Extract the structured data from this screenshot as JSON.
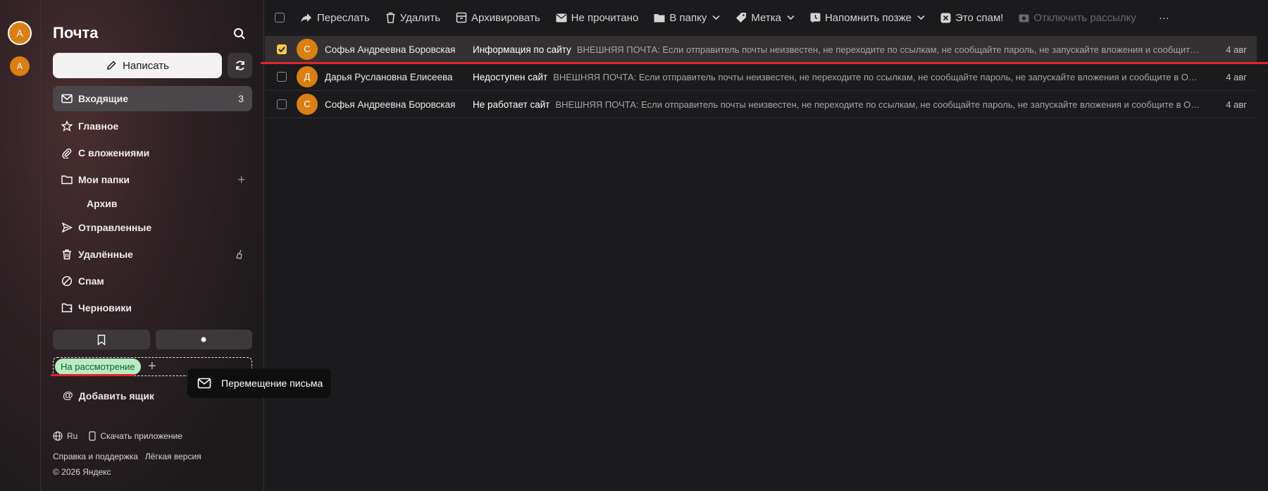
{
  "accounts": {
    "main_initial": "А",
    "secondary_initial": "А"
  },
  "sidebar": {
    "title": "Почта",
    "compose_label": "Написать",
    "items": [
      {
        "label": "Входящие",
        "icon": "envelope-icon",
        "count": "3"
      },
      {
        "label": "Главное",
        "icon": "star-icon"
      },
      {
        "label": "С вложениями",
        "icon": "paperclip-icon"
      },
      {
        "label": "Мои папки",
        "icon": "folder-icon"
      },
      {
        "label": "Архив"
      },
      {
        "label": "Отправленные",
        "icon": "send-icon"
      },
      {
        "label": "Удалённые",
        "icon": "trash-icon"
      },
      {
        "label": "Спам",
        "icon": "spam-icon"
      },
      {
        "label": "Черновики",
        "icon": "draft-icon"
      }
    ],
    "label_chip": "На рассмотрение",
    "add_box": "Добавить ящик",
    "footer": {
      "lang": "Ru",
      "download_app": "Скачать приложение",
      "help": "Справка и поддержка",
      "lite": "Лёгкая версия",
      "copyright": "© 2026 Яндекс"
    }
  },
  "tooltip": {
    "text": "Перемещение письма"
  },
  "toolbar": {
    "forward": "Переслать",
    "delete": "Удалить",
    "archive": "Архивировать",
    "unread": "Не прочитано",
    "to_folder": "В папку",
    "label": "Метка",
    "remind": "Напомнить позже",
    "spam": "Это спам!",
    "unsubscribe": "Отключить рассылку",
    "more": "···"
  },
  "messages": [
    {
      "initial": "С",
      "sender": "Софья Андреевна Боровская",
      "subject": "Информация по сайту",
      "snippet": "ВНЕШНЯЯ ПОЧТА: Если отправитель почты неизвестен, не переходите по ссылкам, не сообщайте пароль, не запускайте вложения и сообщит…",
      "date": "4 авг",
      "selected": true
    },
    {
      "initial": "Д",
      "sender": "Дарья Руслановна Елисеева",
      "subject": "Недоступен сайт",
      "snippet": "ВНЕШНЯЯ ПОЧТА: Если отправитель почты неизвестен, не переходите по ссылкам, не сообщайте пароль, не запускайте вложения и сообщите в О…",
      "date": "4 авг",
      "selected": false
    },
    {
      "initial": "С",
      "sender": "Софья Андреевна Боровская",
      "subject": "Не работает сайт",
      "snippet": "ВНЕШНЯЯ ПОЧТА: Если отправитель почты неизвестен, не переходите по ссылкам, не сообщайте пароль, не запускайте вложения и сообщите в О…",
      "date": "4 авг",
      "selected": false
    }
  ],
  "colors": {
    "accent": "#d97f13",
    "label_bg": "#b8ecc1",
    "highlight_red": "#e0262a",
    "checkbox_checked": "#f5c84a"
  }
}
